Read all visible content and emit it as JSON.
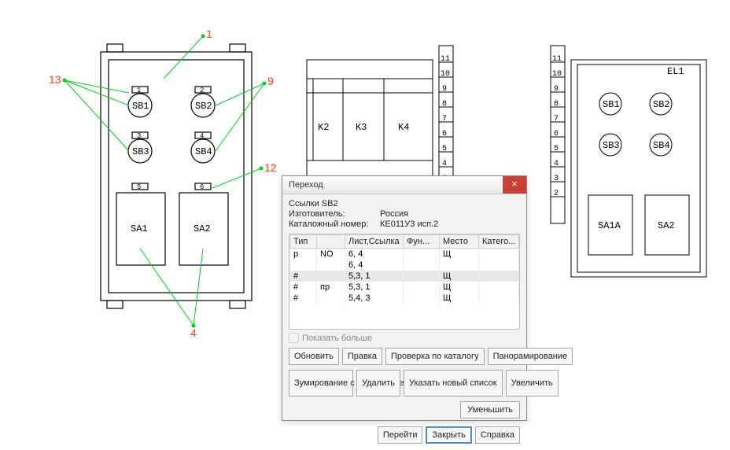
{
  "drawing": {
    "panel1": {
      "buttons": [
        {
          "label": "SB1",
          "tag": "1"
        },
        {
          "label": "SB2",
          "tag": "2"
        },
        {
          "label": "SB3",
          "tag": "3"
        },
        {
          "label": "SB4",
          "tag": "4"
        }
      ],
      "switches": [
        {
          "label": "SA1",
          "tag": "5"
        },
        {
          "label": "SA2",
          "tag": "6"
        }
      ]
    },
    "relays": [
      "K2",
      "K3",
      "K4"
    ],
    "panel2": {
      "title": "EL1",
      "buttons": [
        "SB1",
        "SB2",
        "SB3",
        "SB4"
      ],
      "switches": [
        "SA1A",
        "SA2"
      ]
    },
    "ruler_marks": [
      "2",
      "3",
      "4",
      "5",
      "6",
      "7",
      "8",
      "9",
      "10",
      "11"
    ]
  },
  "annotations": {
    "a1": "1",
    "a4": "4",
    "a9": "9",
    "a12": "12",
    "a13": "13"
  },
  "dialog": {
    "title": "Переход",
    "ref_label": "Ссылки SB2",
    "mfr_label": "Изготовитель:",
    "mfr_value": "Россия",
    "cat_label": "Каталожный номер:",
    "cat_value": "КЕ011У3 исп.2",
    "columns": {
      "c1": "Тип",
      "c2": "",
      "c3": "Лист,Ссылка",
      "c4": "Фун...",
      "c5": "Место",
      "c6": "Катего..."
    },
    "rows": [
      {
        "t": "р",
        "s": "NO",
        "l": "6, 4",
        "f": "",
        "p": "Щ",
        "c": ""
      },
      {
        "t": "",
        "s": "",
        "l": "6, 4",
        "f": "",
        "p": "",
        "c": ""
      },
      {
        "t": "#",
        "s": "",
        "l": "5,3, 1",
        "f": "",
        "p": "Щ",
        "c": "",
        "sel": true
      },
      {
        "t": "#",
        "s": "пр",
        "l": "5,3, 1",
        "f": "",
        "p": "Щ",
        "c": ""
      },
      {
        "t": "#",
        "s": "",
        "l": "5,4, 3",
        "f": "",
        "p": "Щ",
        "c": ""
      }
    ],
    "show_more": "Показать больше",
    "buttons": {
      "refresh": "Обновить",
      "edit": "Правка",
      "check": "Проверка по каталогу",
      "pan": "Панорамирование",
      "zoom_save": "Зумирование с сохранением",
      "delete": "Удалить",
      "new_list": "Указать новый список",
      "zoom_in": "Увеличить",
      "zoom_out": "Уменьшить",
      "go": "Перейти",
      "close": "Закрыть",
      "help": "Справка"
    }
  }
}
